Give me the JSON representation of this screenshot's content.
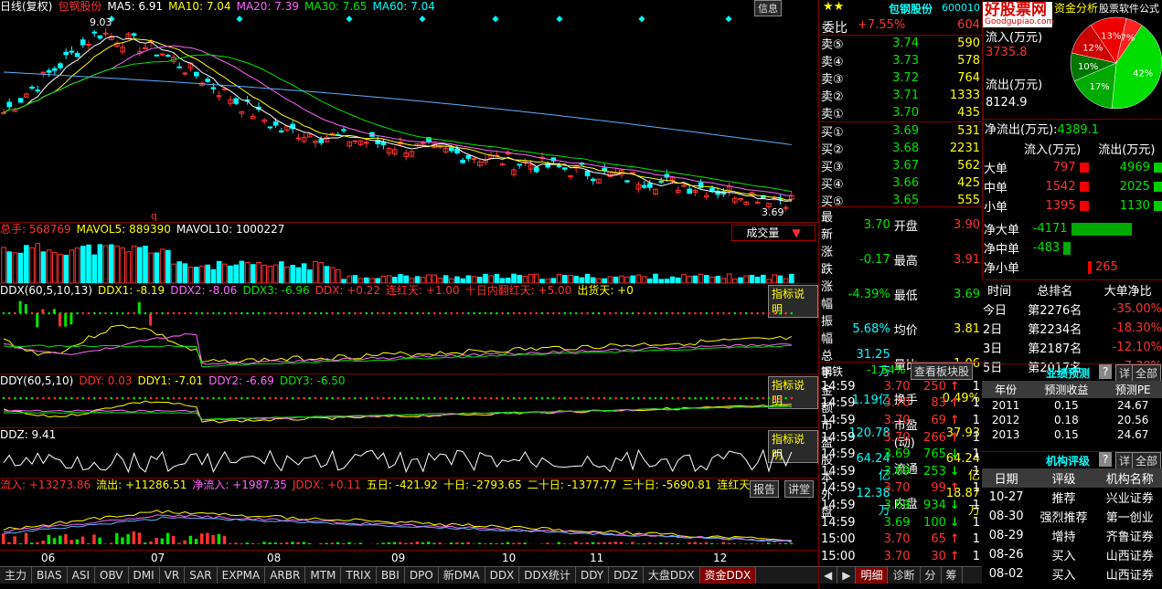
{
  "kline": {
    "label": "日线(复权)",
    "stock": "包钢股份",
    "ma5": "MA5: 6.91",
    "ma10": "MA10: 7.04",
    "ma20": "MA20: 7.39",
    "ma30": "MA30: 7.65",
    "ma60": "MA60: 7.04",
    "high": "9.03",
    "low": "3.69",
    "q": "q",
    "info_btn": "信息"
  },
  "volume": {
    "total": "总手: 568769",
    "mavol5": "MAVOL5: 889390",
    "mavol10": "MAVOL10: 1000227",
    "dropdown": "成交量"
  },
  "ddx": {
    "name": "DDX(60,5,10,13)",
    "ddx1": "DDX1: -8.19",
    "ddx2": "DDX2: -8.06",
    "ddx3": "DDX3: -6.96",
    "ddx": "DDX: +0.22",
    "lian": "连红天: +1.00",
    "shiri": "十日内翻红天: +5.00",
    "chuhuo": "出货天: +0",
    "explain": "指标说明"
  },
  "ddy": {
    "name": "DDY(60,5,10)",
    "ddy": "DDY: 0.03",
    "ddy1": "DDY1: -7.01",
    "ddy2": "DDY2: -6.69",
    "ddy3": "DDY3: -6.50",
    "explain": "指标说明"
  },
  "ddz": {
    "name": "DDZ: 9.41",
    "explain": "指标说明"
  },
  "fund": {
    "inflow": "流入: +13273.86",
    "outflow": "流出: +11286.51",
    "net": "净流入: +1987.35",
    "jddx": "JDDX: +0.11",
    "d5": "五日: -421.92",
    "d10": "十日: -2793.65",
    "d20": "二十日: -1377.77",
    "d30": "三十日: -5690.81",
    "lian": "连红天:",
    "report": "报告",
    "talk": "讲堂"
  },
  "months": [
    "06",
    "07",
    "08",
    "09",
    "10",
    "11",
    "12"
  ],
  "tabs": [
    "主力",
    "BIAS",
    "ASI",
    "OBV",
    "DMI",
    "VR",
    "SAR",
    "EXPMA",
    "ARBR",
    "MTM",
    "TRIX",
    "BBI",
    "DPO",
    "新DMA",
    "DDX",
    "DDX统计",
    "DDY",
    "DDZ",
    "大盘DDX",
    "资金DDX"
  ],
  "quote": {
    "title": "包钢股份",
    "code": "600010",
    "weibi_label": "委比",
    "weibi": "+7.55%",
    "weibi_v": "604",
    "asks": [
      {
        "l": "卖⑤",
        "p": "3.74",
        "v": "590"
      },
      {
        "l": "卖④",
        "p": "3.73",
        "v": "578"
      },
      {
        "l": "卖③",
        "p": "3.72",
        "v": "764"
      },
      {
        "l": "卖②",
        "p": "3.71",
        "v": "1333"
      },
      {
        "l": "卖①",
        "p": "3.70",
        "v": "435"
      }
    ],
    "bids": [
      {
        "l": "买①",
        "p": "3.69",
        "v": "531"
      },
      {
        "l": "买②",
        "p": "3.68",
        "v": "2231"
      },
      {
        "l": "买③",
        "p": "3.67",
        "v": "562"
      },
      {
        "l": "买④",
        "p": "3.66",
        "v": "425"
      },
      {
        "l": "买⑤",
        "p": "3.65",
        "v": "555"
      }
    ],
    "stats": [
      [
        "最新",
        "3.70",
        "开盘",
        "3.90"
      ],
      [
        "涨跌",
        "-0.17",
        "最高",
        "3.91"
      ],
      [
        "涨幅",
        "-4.39%",
        "最低",
        "3.69"
      ],
      [
        "振幅",
        "5.68%",
        "均价",
        "3.81"
      ],
      [
        "总手",
        "31.25万",
        "量比",
        "1.06"
      ],
      [
        "金额",
        "1.19亿",
        "换手",
        "0.49%"
      ],
      [
        "市盈",
        "120.78",
        "市盈(动)",
        "37.93"
      ],
      [
        "股本",
        "64.24亿",
        "流通",
        "64.24亿"
      ],
      [
        "外盘",
        "12.38万",
        "内盘",
        "18.87万"
      ]
    ],
    "sector": "钢铁",
    "sector_chg": "-1.54%",
    "sector_btn": "查看板块股"
  },
  "trades": [
    [
      "14:59",
      "3.70",
      "250",
      "1"
    ],
    [
      "14:59",
      "3.70",
      "83",
      "1"
    ],
    [
      "14:59",
      "3.70",
      "69",
      "1"
    ],
    [
      "14:59",
      "3.70",
      "266",
      "1"
    ],
    [
      "14:59",
      "3.69",
      "765",
      "1"
    ],
    [
      "14:59",
      "3.69",
      "253",
      "1"
    ],
    [
      "14:59",
      "3.70",
      "99",
      "1"
    ],
    [
      "14:59",
      "3.69",
      "934",
      "1"
    ],
    [
      "14:59",
      "3.69",
      "100",
      "1"
    ],
    [
      "15:00",
      "3.70",
      "65",
      "1"
    ],
    [
      "15:00",
      "3.70",
      "30",
      "1"
    ]
  ],
  "trade_tabs": [
    "明细",
    "诊断",
    "分",
    "筹"
  ],
  "flow": {
    "brand": "好股票网",
    "brand_url": "Goodgupiao.com",
    "title": "资金分析",
    "inflow_label": "流入(万元)",
    "inflow": "3735.8",
    "outflow_label": "流出(万元)",
    "outflow": "8124.9",
    "net_label": "净流出(万元):",
    "net": "4389.1",
    "formula": "股票软件公式",
    "pie": [
      {
        "label": "42%",
        "v": 42,
        "c": "#00dd00"
      },
      {
        "label": "17%",
        "v": 17,
        "c": "#00aa00"
      },
      {
        "label": "10%",
        "v": 10,
        "c": "#007700"
      },
      {
        "label": "12%",
        "v": 12,
        "c": "#cc0000"
      },
      {
        "label": "13%",
        "v": 13,
        "c": "#ee0000"
      },
      {
        "label": "7%",
        "v": 6,
        "c": "#ff2222"
      }
    ],
    "col_in": "流入(万元)",
    "col_out": "流出(万元)",
    "rows": [
      {
        "l": "大单",
        "in": "797",
        "out": "4969"
      },
      {
        "l": "中单",
        "in": "1542",
        "out": "2025"
      },
      {
        "l": "小单",
        "in": "1395",
        "out": "1130"
      }
    ],
    "net_rows": [
      {
        "l": "净大单",
        "v": "-4171"
      },
      {
        "l": "净中单",
        "v": "-483"
      },
      {
        "l": "净小单",
        "v": "265"
      }
    ]
  },
  "rank": {
    "h": [
      "时间",
      "总排名",
      "大单净比"
    ],
    "rows": [
      [
        "今日",
        "第2276名",
        "-35.00%"
      ],
      [
        "2日",
        "第2234名",
        "-18.30%"
      ],
      [
        "3日",
        "第2187名",
        "-12.10%"
      ],
      [
        "5日",
        "第2017名",
        "-7.30%"
      ]
    ]
  },
  "forecast": {
    "title": "业绩预测",
    "q": "?",
    "detail": "详",
    "all": "全部",
    "h": [
      "年份",
      "预测收益",
      "预测PE"
    ],
    "rows": [
      [
        "2011",
        "0.15",
        "24.67"
      ],
      [
        "2012",
        "0.18",
        "20.56"
      ],
      [
        "2013",
        "0.15",
        "24.67"
      ]
    ]
  },
  "rating": {
    "title": "机构评级",
    "q": "?",
    "detail": "详",
    "all": "全部",
    "h": [
      "日期",
      "评级",
      "机构名称"
    ],
    "rows": [
      [
        "10-27",
        "推荐",
        "兴业证券"
      ],
      [
        "08-30",
        "强烈推荐",
        "第一创业"
      ],
      [
        "08-29",
        "增持",
        "齐鲁证券"
      ],
      [
        "08-26",
        "买入",
        "山西证券"
      ],
      [
        "08-02",
        "买入",
        "山西证券"
      ]
    ]
  }
}
